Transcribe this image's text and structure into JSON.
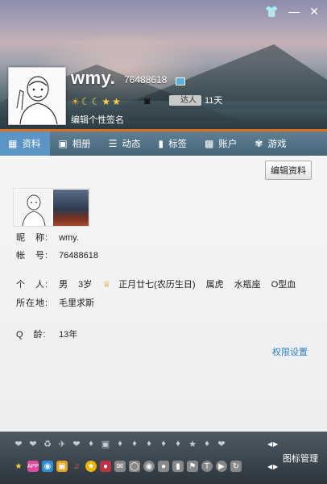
{
  "window": {
    "skin_icon": "shirt-icon",
    "minimize": "—",
    "close": "✕"
  },
  "profile": {
    "nickname": "wmy.",
    "qq_number": "76488618",
    "signature": "编辑个性签名",
    "level_icons": [
      "sun-icon",
      "moon-icon",
      "moon-icon",
      "star-icon",
      "star-icon"
    ],
    "daren_badge": "达人",
    "days": "11天"
  },
  "tabs": [
    {
      "label": "资料",
      "icon": "profile-card-icon",
      "active": true
    },
    {
      "label": "相册",
      "icon": "photo-icon"
    },
    {
      "label": "动态",
      "icon": "feed-icon"
    },
    {
      "label": "标签",
      "icon": "bookmark-icon"
    },
    {
      "label": "账户",
      "icon": "wallet-icon"
    },
    {
      "label": "游戏",
      "icon": "game-icon"
    }
  ],
  "content": {
    "edit_button": "编辑资料",
    "rows": {
      "nickname_label": "昵　称:",
      "nickname_value": "wmy.",
      "account_label": "帐　号:",
      "account_value": "76488618",
      "personal_label": "个　人:",
      "gender": "男",
      "age": "3岁",
      "birthday": "正月廿七(农历生日)",
      "zodiac": "属虎",
      "constellation": "水瓶座",
      "blood": "O型血",
      "location_label": "所在地:",
      "location_value": "毛里求斯",
      "qage_label": "Q　龄:",
      "qage_value": "13年"
    },
    "permission_link": "权限设置"
  },
  "footer": {
    "manage_label": "图标管理",
    "row1_icons": [
      "heart-icon",
      "heart-icon",
      "trophy-icon",
      "plane-icon",
      "heart-icon",
      "diamond-icon",
      "portrait-icon",
      "diamond-icon",
      "diamond-icon",
      "diamond-icon",
      "diamond-icon",
      "diamond-icon",
      "star-icon",
      "diamond-icon",
      "heart-icon"
    ],
    "row2_icons": [
      "star-icon",
      "app-icon",
      "qq-show-icon",
      "gift-icon",
      "music-icon",
      "qzone-icon",
      "pet-icon",
      "mail-icon",
      "shield-icon",
      "music-disc-icon",
      "location-icon",
      "phone-icon",
      "flag-icon",
      "tencent-icon",
      "video-icon",
      "sync-icon"
    ]
  },
  "colors": {
    "accent": "#5b95c6",
    "header_bottom": "#e07020",
    "link": "#2e82c5",
    "footer_bg": "#2c353c"
  }
}
